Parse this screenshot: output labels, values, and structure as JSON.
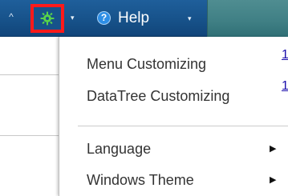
{
  "menubar": {
    "collapse_glyph": "^",
    "gear": {
      "icon": "gear-icon",
      "caret": "▾"
    },
    "help": {
      "icon_glyph": "?",
      "label": "Help",
      "caret": "▾"
    }
  },
  "dropdown": {
    "items": [
      {
        "label": "Menu Customizing"
      },
      {
        "label": "DataTree Customizing"
      },
      {
        "label": "Language",
        "submenu_glyph": "▶"
      },
      {
        "label": "Windows Theme",
        "submenu_glyph": "▶"
      }
    ]
  },
  "right_links": [
    "1",
    "1"
  ],
  "colors": {
    "menubar": "#17528a",
    "highlight_border": "#ff1a1a",
    "gear_green": "#58d24a",
    "help_icon": "#2d8ee6"
  }
}
